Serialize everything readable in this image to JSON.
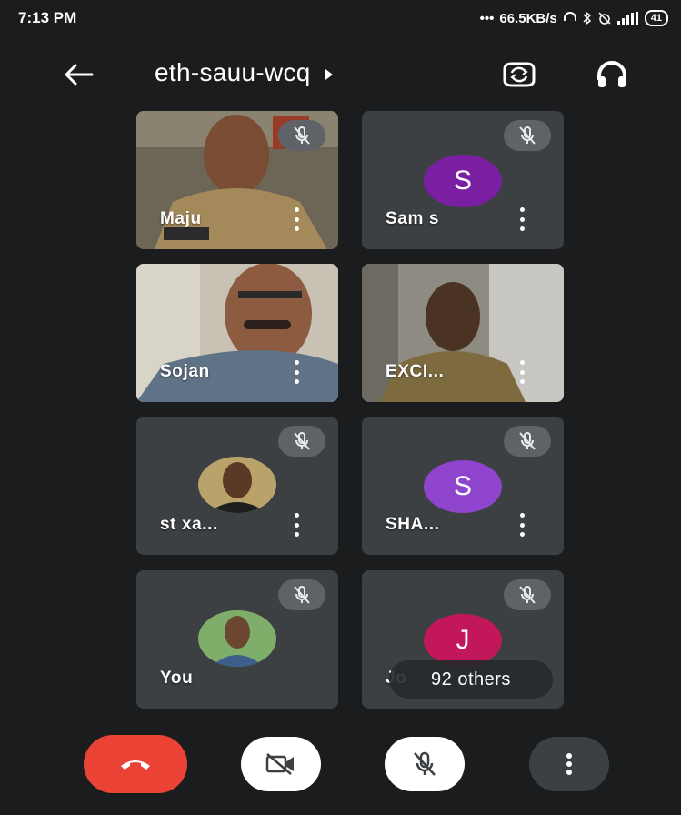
{
  "status_bar": {
    "time": "7:13 PM",
    "network_speed": "66.5KB/s",
    "battery": "41",
    "icons": [
      "dots-icon",
      "headphones-icon",
      "bluetooth-icon",
      "alarm-off-icon",
      "signal-icon",
      "battery-icon"
    ]
  },
  "top_bar": {
    "back_icon": "arrow-left-icon",
    "meeting_code": "eth-sauu-wcq",
    "caret_icon": "caret-right-icon",
    "switch_camera_icon": "switch-camera-icon",
    "audio_output_icon": "headphones-icon"
  },
  "participants": [
    {
      "name": "Maju",
      "type": "video",
      "muted": true
    },
    {
      "name": "Sam s",
      "type": "letter",
      "initial": "S",
      "color": "#7b1fa2",
      "muted": true
    },
    {
      "name": "Sojan",
      "type": "video",
      "muted": false
    },
    {
      "name": "EXCI...",
      "type": "video",
      "muted": false
    },
    {
      "name": "st xa...",
      "type": "photo",
      "muted": true
    },
    {
      "name": "SHA...",
      "type": "letter",
      "initial": "S",
      "color": "#8e44cc",
      "muted": true
    },
    {
      "name": "You",
      "type": "photo",
      "muted": true
    },
    {
      "name": "Jo",
      "type": "letter",
      "initial": "J",
      "color": "#c2185b",
      "muted": true
    }
  ],
  "others_chip": "92 others",
  "controls": {
    "hangup_icon": "call-end-icon",
    "camera_icon": "videocam-off-icon",
    "mic_icon": "mic-off-icon",
    "more_icon": "more-vert-icon"
  },
  "colors": {
    "background": "#1b1c1e",
    "tile": "#3c4043",
    "hangup": "#ea4335",
    "mute_badge": "#5f6368"
  }
}
